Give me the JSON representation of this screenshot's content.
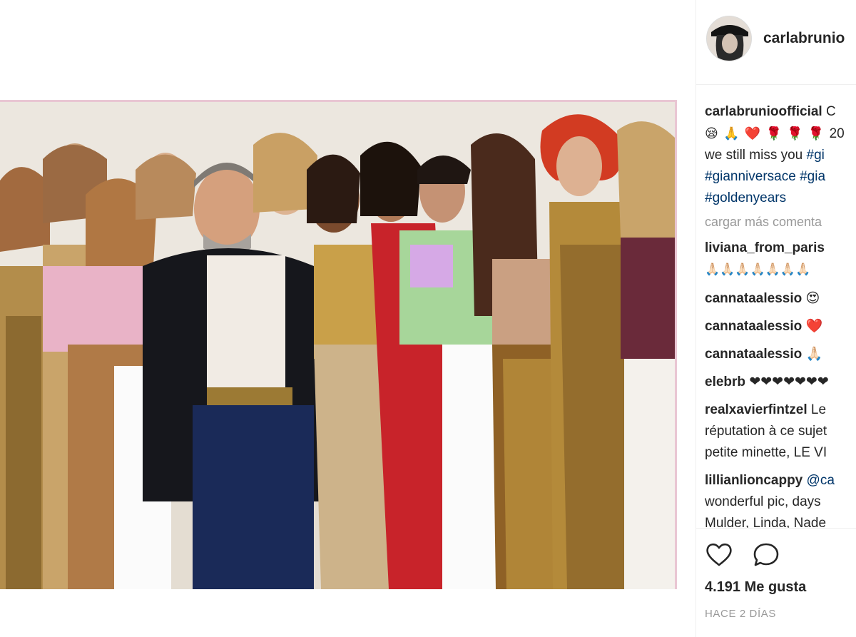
{
  "post": {
    "username": "carlabrunio",
    "image_alt": "Group photo of Gianni Versace with models in Versace prints"
  },
  "caption": {
    "username": "carlabrunioofficial",
    "text_tail": "C",
    "line2_emojis": [
      "😪",
      "🙏",
      "❤️",
      "🌹",
      "🌹",
      "🌹"
    ],
    "line2_text": "20",
    "line3_text": "we still miss you",
    "line3_tag": "#gi",
    "line4_tag1": "#gianniversace",
    "line4_tag2": "#gia",
    "line5_tag": "#goldenyears"
  },
  "load_more": "cargar más comenta",
  "comments": [
    {
      "username": "liviana_from_paris",
      "text": ""
    },
    {
      "username": "",
      "text": "🙏🏻🙏🏻🙏🏻🙏🏻🙏🏻🙏🏻🙏🏻"
    },
    {
      "username": "cannataalessio",
      "text": "😍"
    },
    {
      "username": "cannataalessio",
      "text": "❤️"
    },
    {
      "username": "cannataalessio",
      "text": "🙏🏻"
    },
    {
      "username": "elebrb",
      "text": "❤❤❤❤❤❤❤"
    },
    {
      "username": "realxavierfintzel",
      "text": "Le",
      "more": [
        "réputation à ce sujet",
        "petite minette, LE VI"
      ]
    },
    {
      "username": "lillianlioncappy",
      "text": "@ca",
      "more": [
        "wonderful pic, days",
        "Mulder, Linda, Nade"
      ]
    }
  ],
  "likes": "4.191 Me gusta",
  "timestamp": "HACE 2 DÍAS",
  "colors": {
    "link": "#003569",
    "muted": "#999999",
    "text": "#262626"
  },
  "icons": {
    "like": "heart-outline-icon",
    "comment": "speech-bubble-icon"
  }
}
